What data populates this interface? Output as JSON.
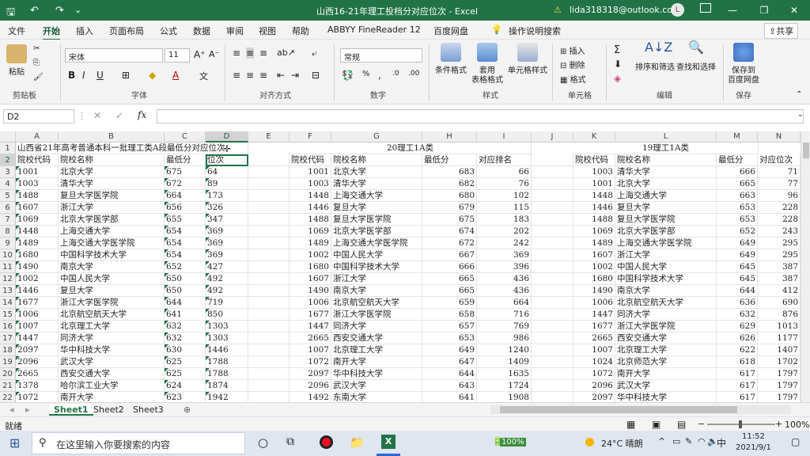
{
  "title_bar": {
    "title": "山西16-21年理工投档分对应位次 - Excel",
    "account": "lida318318@outlook.com",
    "avatar_letter": "L"
  },
  "menu": [
    "文件",
    "开始",
    "插入",
    "页面布局",
    "公式",
    "数据",
    "审阅",
    "视图",
    "帮助",
    "ABBYY FineReader 12",
    "百度网盘",
    "操作说明搜索"
  ],
  "share_label": "共享",
  "ribbon": {
    "paste": "粘贴",
    "clipboard": "剪贴板",
    "font_name": "宋体",
    "font_size": "11",
    "font": "字体",
    "alignment": "对齐方式",
    "number_format": "常规",
    "number": "数字",
    "cond_format": "条件格式",
    "table_format_1": "套用",
    "table_format_2": "表格格式",
    "cell_style": "单元格样式",
    "styles": "样式",
    "insert": "插入",
    "delete": "删除",
    "format": "格式",
    "cells": "单元格",
    "sort_filter": "排序和筛选",
    "find_select": "查找和选择",
    "editing": "编辑",
    "save_to_1": "保存到",
    "save_to_2": "百度网盘",
    "save": "保存"
  },
  "name_box": "D2",
  "formula_content": "",
  "columns": [
    "A",
    "B",
    "C",
    "D",
    "E",
    "F",
    "G",
    "H",
    "I",
    "J",
    "K",
    "L",
    "M",
    "N"
  ],
  "row1": {
    "a": "山西省21年高考普通本科一批理工类A段最低分对应位次",
    "g": "20理工1A类",
    "l": "19理工1A类"
  },
  "headers": {
    "a": "院校代码",
    "b": "院校名称",
    "c": "最低分",
    "d": "位次",
    "f": "院校代码",
    "g": "院校名称",
    "h": "最低分",
    "i": "对应排名",
    "k": "院校代码",
    "l": "院校名称",
    "m": "最低分",
    "n": "对应位次"
  },
  "rows": [
    [
      "1001",
      "北京大学",
      "675",
      "64",
      "1001",
      "北京大学",
      "683",
      "66",
      "1003",
      "清华大学",
      "666",
      "71"
    ],
    [
      "1003",
      "清华大学",
      "672",
      "89",
      "1003",
      "清华大学",
      "682",
      "76",
      "1001",
      "北京大学",
      "665",
      "77"
    ],
    [
      "1488",
      "复旦大学医学院",
      "664",
      "173",
      "1448",
      "上海交通大学",
      "680",
      "102",
      "1448",
      "上海交通大学",
      "663",
      "96"
    ],
    [
      "1607",
      "浙江大学",
      "656",
      "326",
      "1446",
      "复旦大学",
      "679",
      "115",
      "1446",
      "复旦大学",
      "653",
      "228"
    ],
    [
      "1069",
      "北京大学医学部",
      "655",
      "347",
      "1488",
      "复旦大学医学院",
      "675",
      "183",
      "1488",
      "复旦大学医学院",
      "653",
      "228"
    ],
    [
      "1448",
      "上海交通大学",
      "654",
      "369",
      "1069",
      "北京大学医学部",
      "674",
      "202",
      "1069",
      "北京大学医学部",
      "652",
      "243"
    ],
    [
      "1489",
      "上海交通大学医学院",
      "654",
      "369",
      "1489",
      "上海交通大学医学院",
      "672",
      "242",
      "1489",
      "上海交通大学医学院",
      "649",
      "295"
    ],
    [
      "1680",
      "中国科学技术大学",
      "654",
      "369",
      "1002",
      "中国人民大学",
      "667",
      "369",
      "1607",
      "浙江大学",
      "649",
      "295"
    ],
    [
      "1490",
      "南京大学",
      "652",
      "427",
      "1680",
      "中国科学技术大学",
      "666",
      "396",
      "1002",
      "中国人民大学",
      "645",
      "387"
    ],
    [
      "1002",
      "中国人民大学",
      "650",
      "492",
      "1607",
      "浙江大学",
      "665",
      "436",
      "1680",
      "中国科学技术大学",
      "645",
      "387"
    ],
    [
      "1446",
      "复旦大学",
      "650",
      "492",
      "1490",
      "南京大学",
      "665",
      "436",
      "1490",
      "南京大学",
      "644",
      "412"
    ],
    [
      "1677",
      "浙江大学医学院",
      "644",
      "719",
      "1006",
      "北京航空航天大学",
      "659",
      "664",
      "1006",
      "北京航空航天大学",
      "636",
      "690"
    ],
    [
      "1006",
      "北京航空航天大学",
      "641",
      "850",
      "1677",
      "浙江大学医学院",
      "658",
      "716",
      "1447",
      "同济大学",
      "632",
      "876"
    ],
    [
      "1007",
      "北京理工大学",
      "632",
      "1303",
      "1447",
      "同济大学",
      "657",
      "769",
      "1677",
      "浙江大学医学院",
      "629",
      "1013"
    ],
    [
      "1447",
      "同济大学",
      "632",
      "1303",
      "2665",
      "西安交通大学",
      "653",
      "986",
      "2665",
      "西安交通大学",
      "626",
      "1177"
    ],
    [
      "2097",
      "华中科技大学",
      "630",
      "1446",
      "1007",
      "北京理工大学",
      "649",
      "1240",
      "1007",
      "北京理工大学",
      "622",
      "1407"
    ],
    [
      "2096",
      "武汉大学",
      "625",
      "1788",
      "1072",
      "南开大学",
      "647",
      "1409",
      "1024",
      "北京师范大学",
      "618",
      "1702"
    ],
    [
      "2665",
      "西安交通大学",
      "625",
      "1788",
      "2097",
      "华中科技大学",
      "644",
      "1635",
      "1072",
      "南开大学",
      "617",
      "1797"
    ],
    [
      "1378",
      "哈尔滨工业大学",
      "624",
      "1874",
      "2096",
      "武汉大学",
      "643",
      "1724",
      "2096",
      "武汉大学",
      "617",
      "1797"
    ],
    [
      "1072",
      "南开大学",
      "623",
      "1942",
      "1492",
      "东南大学",
      "641",
      "1908",
      "2097",
      "华中科技大学",
      "617",
      "1797"
    ]
  ],
  "sheets": [
    "Sheet1",
    "Sheet2",
    "Sheet3"
  ],
  "status": {
    "ready": "就绪",
    "zoom": "100%"
  },
  "taskbar": {
    "search_placeholder": "在这里输入你要搜索的内容",
    "battery": "100%",
    "weather": "24°C 晴朗",
    "ime": "中",
    "time": "11:52",
    "date": "2021/9/1"
  }
}
